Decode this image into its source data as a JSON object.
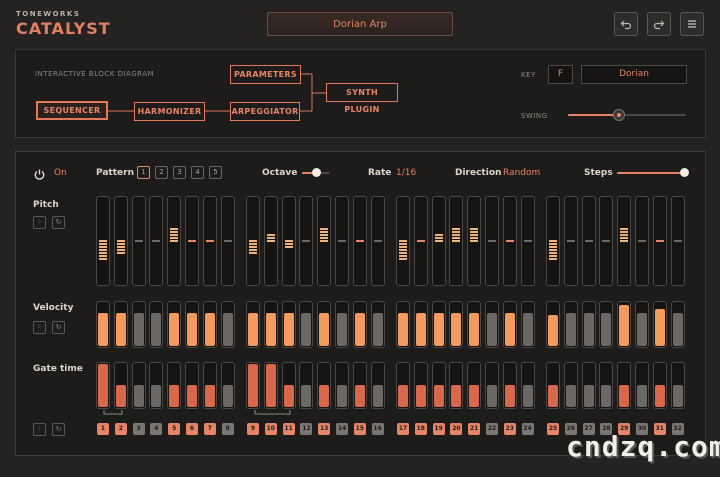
{
  "header": {
    "brand_small": "TONEWORKS",
    "brand_name": "CATALYST",
    "preset_name": "Dorian Arp",
    "icons": [
      "undo-icon",
      "redo-icon",
      "menu-icon"
    ]
  },
  "block_panel": {
    "title": "INTERACTIVE BLOCK DIAGRAM",
    "blocks": {
      "sequencer": "SEQUENCER",
      "harmonizer": "HARMONIZER",
      "parameters": "PARAMETERS",
      "arpeggiator": "ARPEGGIATOR",
      "synth_plugin": "SYNTH PLUGIN"
    },
    "key_label": "KEY",
    "key_value": "F",
    "scale_value": "Dorian",
    "swing_label": "SWING",
    "swing_value": 0.42
  },
  "sequencer": {
    "power_label": "On",
    "pattern_label": "Pattern",
    "patterns": [
      "1",
      "2",
      "3",
      "4",
      "5"
    ],
    "selected_pattern": "1",
    "octave_label": "Octave",
    "octave_value": 0.5,
    "rate_label": "Rate",
    "rate_value": "1/16",
    "direction_label": "Direction",
    "direction_value": "Random",
    "steps_label": "Steps",
    "steps_value": 1.0,
    "rows": {
      "pitch": "Pitch",
      "velocity": "Velocity",
      "gate": "Gate time"
    },
    "step_numbers": [
      "1",
      "2",
      "3",
      "4",
      "5",
      "6",
      "7",
      "8",
      "9",
      "10",
      "11",
      "12",
      "13",
      "14",
      "15",
      "16",
      "17",
      "18",
      "19",
      "20",
      "21",
      "22",
      "23",
      "24",
      "25",
      "26",
      "27",
      "28",
      "29",
      "30",
      "31",
      "32"
    ],
    "active_steps": [
      1,
      2,
      5,
      6,
      7,
      9,
      10,
      11,
      13,
      15,
      17,
      18,
      19,
      20,
      21,
      23,
      25,
      29,
      31
    ],
    "pitch_offsets": [
      -3,
      -2,
      0,
      0,
      2,
      0,
      0,
      0,
      -2,
      1,
      -1,
      0,
      2,
      0,
      0,
      0,
      -3,
      0,
      1,
      2,
      2,
      0,
      0,
      0,
      -3,
      0,
      0,
      0,
      2,
      0,
      0,
      0
    ],
    "velocity_levels": [
      0.8,
      0.8,
      0.8,
      0.8,
      0.8,
      0.8,
      0.8,
      0.8,
      0.8,
      0.8,
      0.8,
      0.8,
      0.8,
      0.8,
      0.8,
      0.8,
      0.8,
      0.8,
      0.8,
      0.8,
      0.8,
      0.8,
      0.8,
      0.8,
      0.75,
      0.8,
      0.8,
      0.8,
      1.0,
      0.8,
      0.9,
      0.8
    ],
    "gate_levels": [
      1.0,
      0.5,
      0.5,
      0.5,
      0.5,
      0.5,
      0.5,
      0.5,
      1.0,
      1.0,
      0.5,
      0.5,
      0.5,
      0.5,
      0.5,
      0.5,
      0.5,
      0.5,
      0.5,
      0.5,
      0.5,
      0.5,
      0.5,
      0.5,
      0.5,
      0.5,
      0.5,
      0.5,
      0.5,
      0.5,
      0.5,
      0.5
    ],
    "colors": {
      "active": "#e58466",
      "pitch_active": "#f0b47a",
      "velocity_active": "#f39a5e",
      "gate_active": "#d8684b",
      "inactive": "#6b6866"
    }
  },
  "watermark": "cndzq.com"
}
